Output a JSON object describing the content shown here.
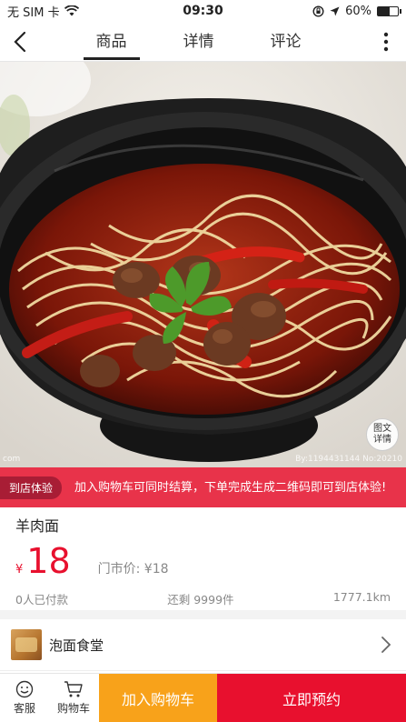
{
  "status": {
    "carrier": "无 SIM 卡",
    "time": "09:30",
    "battery_pct": "60%",
    "battery_level": 0.6
  },
  "nav": {
    "tabs": [
      {
        "label": "商品",
        "active": true
      },
      {
        "label": "详情",
        "active": false
      },
      {
        "label": "评论",
        "active": false
      }
    ]
  },
  "hero": {
    "detail_badge": "图文\n详情",
    "watermark_left": "com",
    "watermark_right": "By:1194431144 No:20210"
  },
  "promo": {
    "tag": "到店体验",
    "text": "加入购物车可同时结算，下单完成生成二维码即可到店体验!"
  },
  "product": {
    "name": "羊肉面",
    "currency": "¥",
    "price": "18",
    "original_price": "门市价: ¥18",
    "paid_count": "0人已付款",
    "stock": "还剩 9999件",
    "distance": "1777.1km"
  },
  "shop": {
    "name": "泡面食堂"
  },
  "bottom": {
    "service_label": "客服",
    "cart_label": "购物车",
    "add_cart": "加入购物车",
    "book_now": "立即预约"
  },
  "colors": {
    "accent_red": "#e8102e",
    "promo_red": "#e8334a",
    "orange": "#f8a21a"
  }
}
